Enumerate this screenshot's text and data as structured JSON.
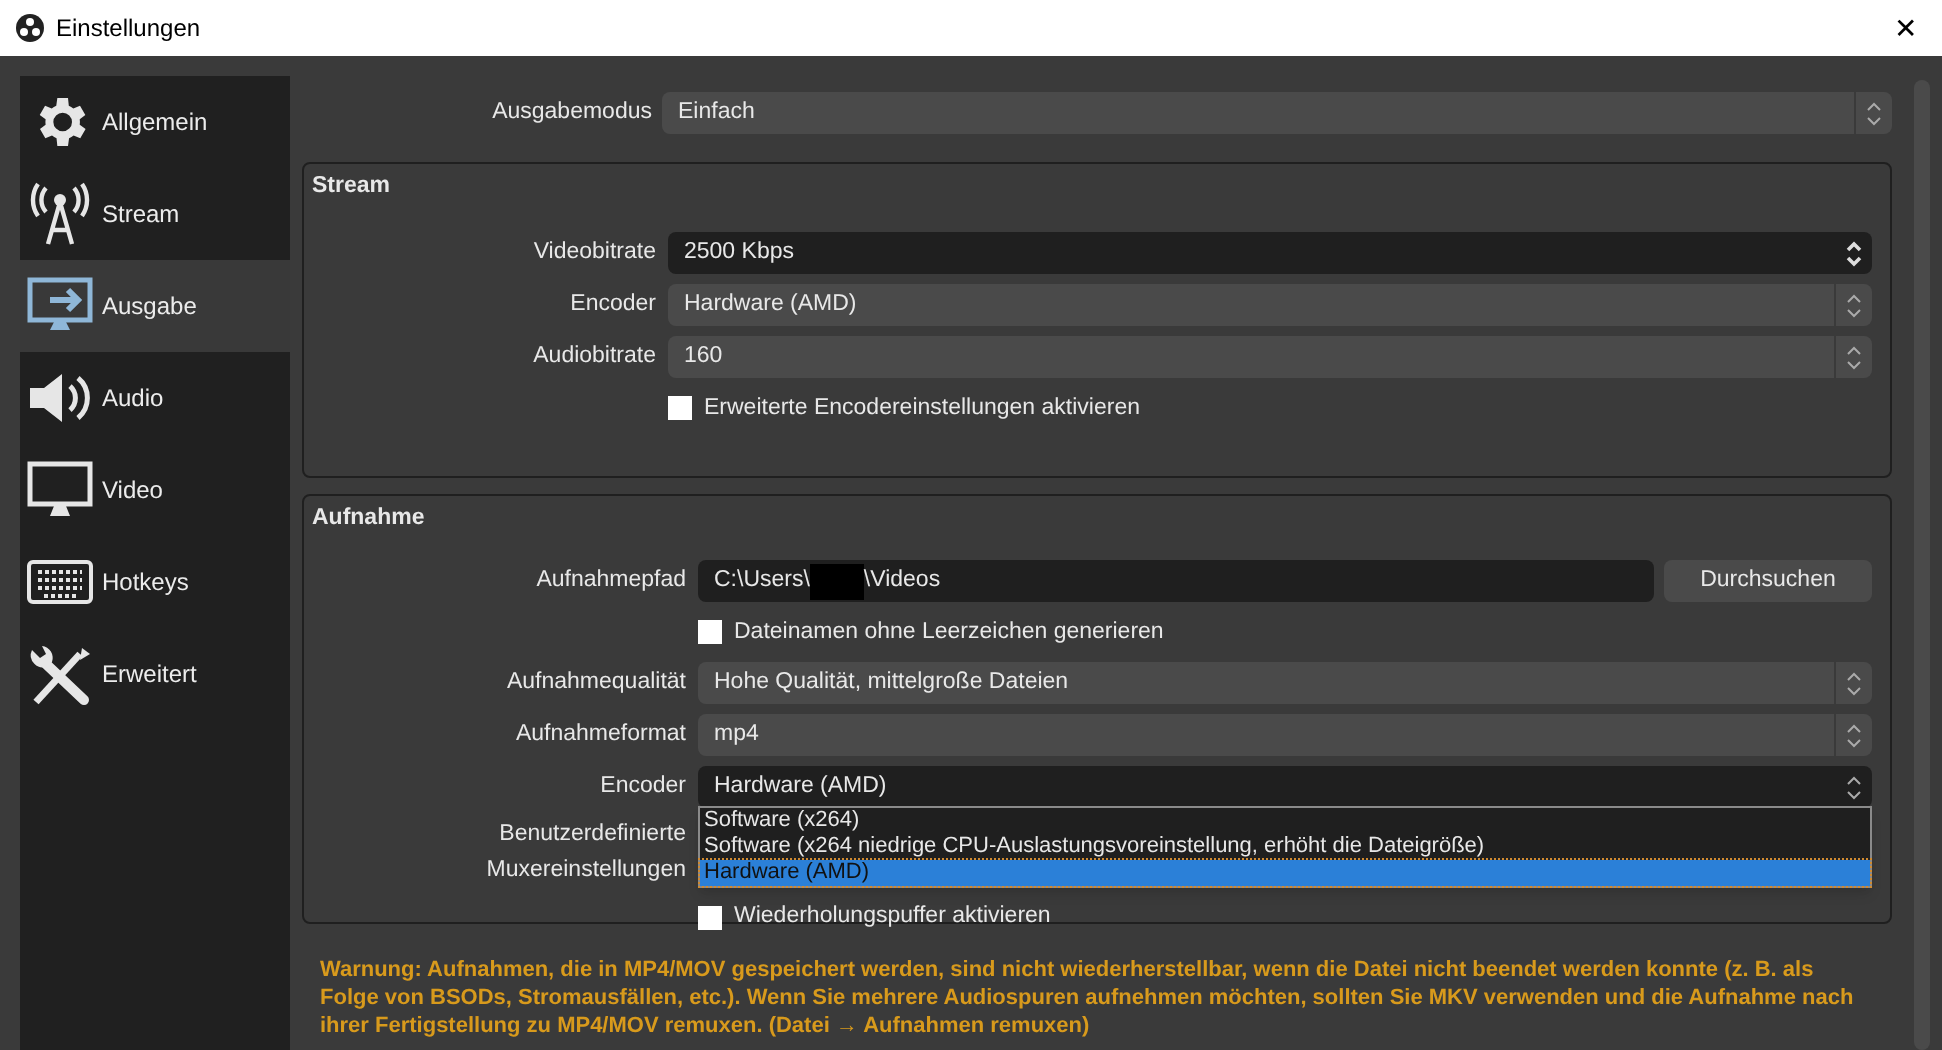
{
  "window": {
    "title": "Einstellungen",
    "close": "✕"
  },
  "sidebar": {
    "items": [
      {
        "label": "Allgemein",
        "selected": false
      },
      {
        "label": "Stream",
        "selected": false
      },
      {
        "label": "Ausgabe",
        "selected": true
      },
      {
        "label": "Audio",
        "selected": false
      },
      {
        "label": "Video",
        "selected": false
      },
      {
        "label": "Hotkeys",
        "selected": false
      },
      {
        "label": "Erweitert",
        "selected": false
      }
    ]
  },
  "output_mode": {
    "label": "Ausgabemodus",
    "value": "Einfach"
  },
  "stream": {
    "title": "Stream",
    "rows": [
      {
        "kind": "spinbox",
        "label": "Videobitrate",
        "value": "2500 Kbps"
      },
      {
        "kind": "combo",
        "label": "Encoder",
        "value": "Hardware (AMD)"
      },
      {
        "kind": "combo",
        "label": "Audiobitrate",
        "value": "160"
      },
      {
        "kind": "checkbox",
        "label": "Erweiterte Encodereinstellungen aktivieren",
        "checked": false
      }
    ]
  },
  "recording": {
    "title": "Aufnahme",
    "rows": [
      {
        "kind": "path",
        "label": "Aufnahmepfad",
        "value_parts": [
          "C:\\Users\\",
          "\\Videos"
        ],
        "button": "Durchsuchen"
      },
      {
        "kind": "checkbox",
        "label": "Dateinamen ohne Leerzeichen generieren",
        "checked": false
      },
      {
        "kind": "combo",
        "label": "Aufnahmequalität",
        "value": "Hohe Qualität, mittelgroße Dateien"
      },
      {
        "kind": "combo",
        "label": "Aufnahmeformat",
        "value": "mp4"
      },
      {
        "kind": "dropdown",
        "label": "Encoder",
        "value": "Hardware (AMD)",
        "options": [
          {
            "label": "Software (x264)",
            "selected": false
          },
          {
            "label": "Software (x264 niedrige CPU-Auslastungsvoreinstellung, erhöht die Dateigröße)",
            "selected": false
          },
          {
            "label": "Hardware (AMD)",
            "selected": true
          }
        ]
      },
      {
        "kind": "text",
        "label": "Benutzerdefinierte Muxereinstellungen"
      },
      {
        "kind": "checkbox",
        "label": "Wiederholungspuffer aktivieren",
        "checked": false
      }
    ]
  },
  "warning": "Warnung: Aufnahmen, die in MP4/MOV gespeichert werden, sind nicht wiederherstellbar, wenn die Datei nicht beendet werden konnte (z. B. als Folge von BSODs, Stromausfällen, etc.). Wenn Sie mehrere Audiospuren aufnehmen möchten, sollten Sie MKV verwenden und die Aufnahme nach ihrer Fertigstellung zu MP4/MOV remuxen. (Datei → Aufnahmen remuxen)"
}
